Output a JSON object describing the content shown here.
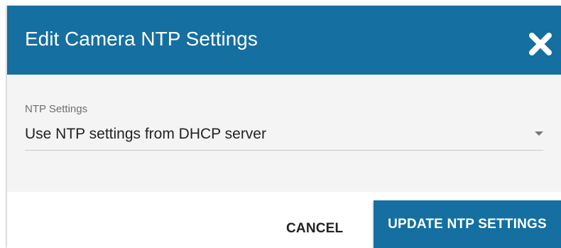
{
  "dialog": {
    "title": "Edit Camera NTP Settings",
    "close_icon": "close-x-icon"
  },
  "form": {
    "ntp_label": "NTP Settings",
    "ntp_selected": "Use NTP settings from DHCP server"
  },
  "footer": {
    "cancel_label": "CANCEL",
    "update_label": "UPDATE NTP SETTINGS"
  },
  "colors": {
    "header_bg": "#156fa0",
    "body_bg": "#f4f4f4",
    "primary_button": "#156fa0"
  }
}
